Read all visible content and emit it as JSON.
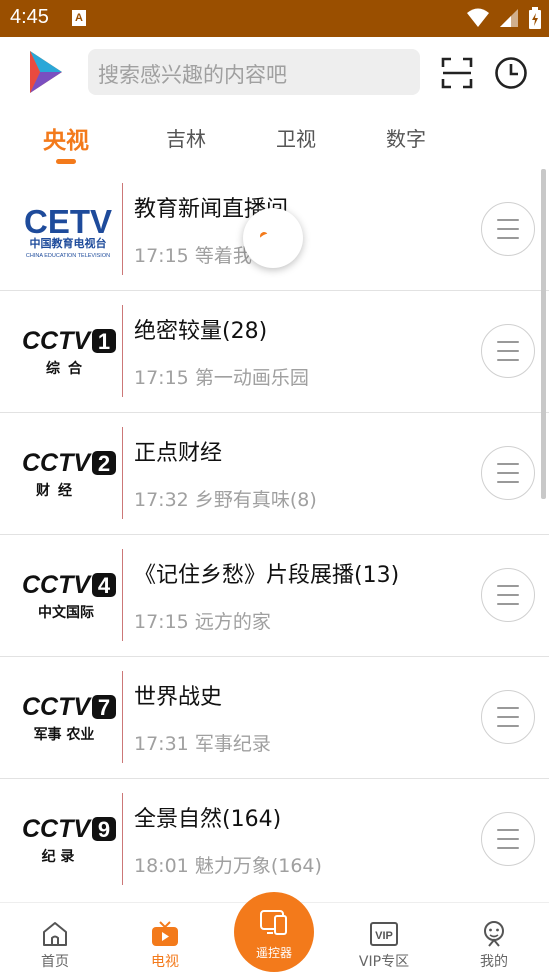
{
  "status_bar": {
    "time": "4:45",
    "notification_letter": "A"
  },
  "search": {
    "placeholder": "搜索感兴趣的内容吧"
  },
  "tabs": [
    {
      "label": "央视",
      "active": true
    },
    {
      "label": "吉林",
      "active": false
    },
    {
      "label": "卫视",
      "active": false
    },
    {
      "label": "数字",
      "active": false
    }
  ],
  "channels": [
    {
      "logo_name": "cetv-logo",
      "logo_main": "CETV",
      "logo_cn": "中国教育电视台",
      "logo_en": "CHINA EDUCATION TELEVISION",
      "title": "教育新闻直播间",
      "time": "17:15",
      "subtitle": "等着我"
    },
    {
      "logo_name": "cctv1-logo",
      "logo_main": "CCTV",
      "logo_num": "1",
      "logo_cn": "综合",
      "title": "绝密较量(28)",
      "time": "17:15",
      "subtitle": "第一动画乐园"
    },
    {
      "logo_name": "cctv2-logo",
      "logo_main": "CCTV",
      "logo_num": "2",
      "logo_cn": "财经",
      "title": "正点财经",
      "time": "17:32",
      "subtitle": "乡野有真味(8)"
    },
    {
      "logo_name": "cctv4-logo",
      "logo_main": "CCTV",
      "logo_num": "4",
      "logo_cn": "中文国际",
      "title": "《记住乡愁》片段展播(13)",
      "time": "17:15",
      "subtitle": "远方的家"
    },
    {
      "logo_name": "cctv7-logo",
      "logo_main": "CCTV",
      "logo_num": "7",
      "logo_cn": "军事 农业",
      "title": "世界战史",
      "time": "17:31",
      "subtitle": "军事纪录"
    },
    {
      "logo_name": "cctv9-logo",
      "logo_main": "CCTV",
      "logo_num": "9",
      "logo_cn": "纪 录",
      "title": "全景自然(164)",
      "time": "18:01",
      "subtitle": "魅力万象(164)"
    }
  ],
  "bottom_nav": {
    "home": "首页",
    "tv": "电视",
    "remote": "遥控器",
    "vip": "VIP专区",
    "mine": "我的",
    "vip_icon_text": "VIP"
  },
  "colors": {
    "accent": "#f37a1b",
    "status_bar": "#9a4f00",
    "muted_text": "#a0a0a0"
  }
}
